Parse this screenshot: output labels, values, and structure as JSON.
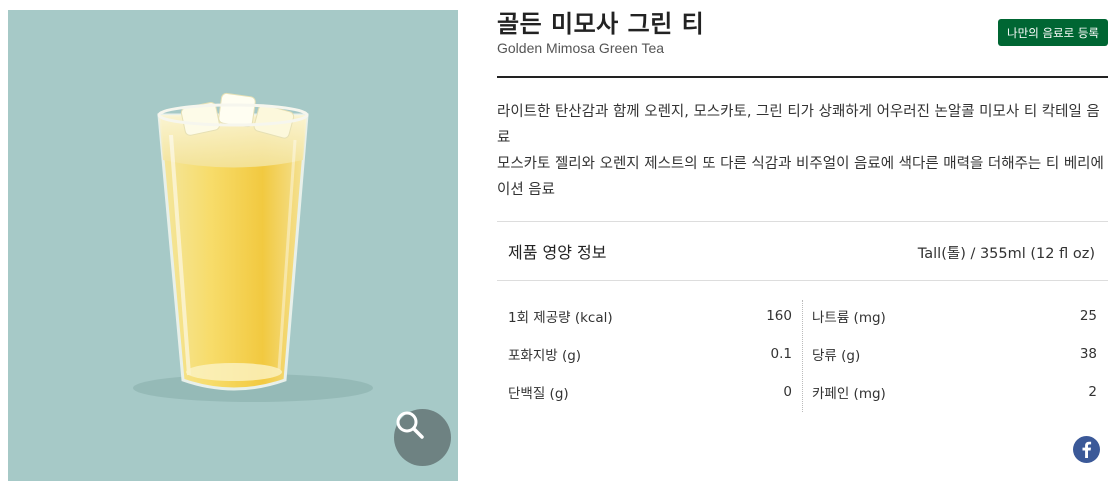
{
  "product": {
    "name_ko": "골든 미모사 그린 티",
    "name_en": "Golden Mimosa Green Tea",
    "register_label": "나만의 음료로 등록",
    "description": [
      "라이트한 탄산감과 함께 오렌지, 모스카토, 그린 티가 상쾌하게 어우러진 논알콜 미모사 티 칵테일 음료",
      "모스카토 젤리와 오렌지 제스트의 또 다른 식감과 비주얼이 음료에 색다른 매력을 더해주는 티 베리에이션 음료"
    ]
  },
  "nutrition": {
    "title": "제품 영양 정보",
    "size": "Tall(톨) / 355ml (12 fl oz)",
    "left": [
      {
        "label": "1회 제공량 (kcal)",
        "value": "160"
      },
      {
        "label": "포화지방 (g)",
        "value": "0.1"
      },
      {
        "label": "단백질 (g)",
        "value": "0"
      }
    ],
    "right": [
      {
        "label": "나트륨 (mg)",
        "value": "25"
      },
      {
        "label": "당류 (g)",
        "value": "38"
      },
      {
        "label": "카페인 (mg)",
        "value": "2"
      }
    ]
  },
  "icons": {
    "zoom": "search-icon",
    "share": "facebook-icon"
  },
  "colors": {
    "brand_green": "#006633",
    "image_bg": "#a6c9c7",
    "facebook_blue": "#3b5998"
  }
}
